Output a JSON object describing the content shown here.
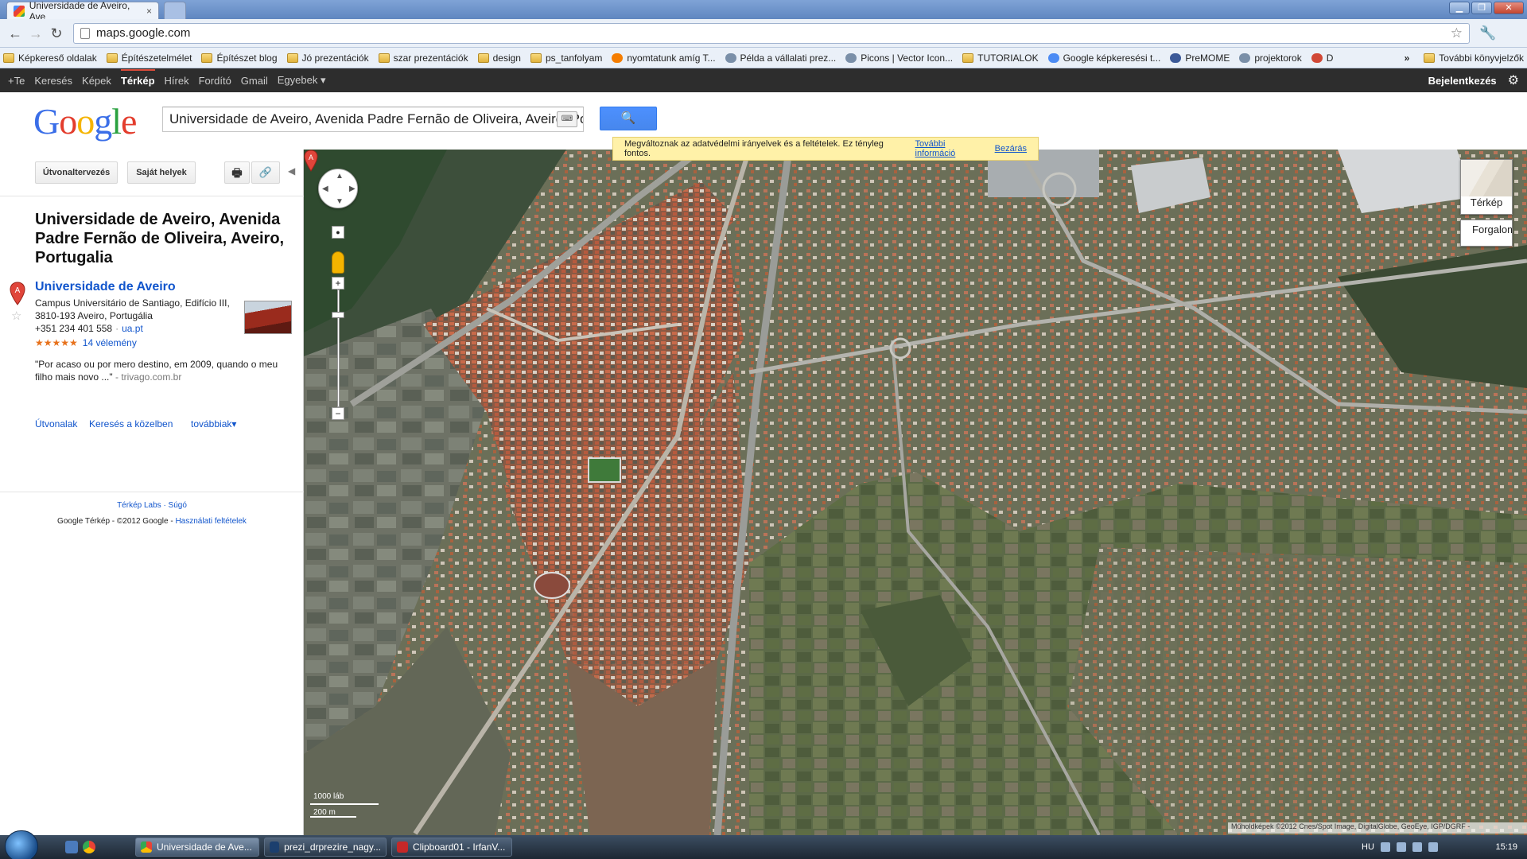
{
  "browser": {
    "tab_title": "Universidade de Aveiro, Ave",
    "tab_close": "×",
    "url": "maps.google.com",
    "window_min": "▁",
    "window_max": "❐",
    "window_close": "✕",
    "bookmarks": [
      {
        "label": "Képkereső oldalak",
        "icon": "folder-icon"
      },
      {
        "label": "Építészetelmélet",
        "icon": "folder-icon"
      },
      {
        "label": "Építészet blog",
        "icon": "folder-icon"
      },
      {
        "label": "Jó prezentációk",
        "icon": "folder-icon"
      },
      {
        "label": "szar prezentációk",
        "icon": "folder-icon"
      },
      {
        "label": "design",
        "icon": "folder-icon"
      },
      {
        "label": "ps_tanfolyam",
        "icon": "folder-icon"
      },
      {
        "label": "nyomtatunk amíg T...",
        "icon": "blogger-icon"
      },
      {
        "label": "Példa a vállalati prez...",
        "icon": "site-icon"
      },
      {
        "label": "Picons | Vector Icon...",
        "icon": "site-icon"
      },
      {
        "label": "TUTORIALOK",
        "icon": "folder-icon"
      },
      {
        "label": "Google képkeresési t...",
        "icon": "google-icon"
      },
      {
        "label": "PreMOME",
        "icon": "facebook-icon"
      },
      {
        "label": "projektorok",
        "icon": "site-icon"
      },
      {
        "label": "D",
        "icon": "gmail-icon"
      }
    ],
    "bookmarks_overflow": "»",
    "other_bookmarks": "További könyvjelzők"
  },
  "gbar": {
    "items": [
      "+Te",
      "Keresés",
      "Képek",
      "Térkép",
      "Hírek",
      "Fordító",
      "Gmail",
      "Egyebek ▾"
    ],
    "active_index": 3,
    "signin": "Bejelentkezés"
  },
  "search": {
    "logo": "Google",
    "query": "Universidade de Aveiro, Avenida Padre Fernão de Oliveira, Aveiro, Portugalia",
    "notice_text": "Megváltoznak az adatvédelmi irányelvek és a feltételek. Ez tényleg fontos.",
    "notice_more": "További információ",
    "notice_close": "Bezárás"
  },
  "panel": {
    "route_button": "Útvonaltervezés",
    "places_button": "Saját helyek",
    "place_title": "Universidade de Aveiro, Avenida Padre Fernão de Oliveira, Aveiro, Portugalia",
    "result": {
      "marker": "A",
      "name": "Universidade de Aveiro",
      "address_line1": "Campus Universitário de Santiago, Edifício III,",
      "address_line2": "3810-193 Aveiro, Portugália",
      "phone": "+351 234 401 558",
      "website": "ua.pt",
      "rating": 5,
      "stars": "★★★★★",
      "reviews": "14 vélemény",
      "quote": "\"Por acaso ou por mero destino, em 2009, quando o meu filho mais novo ...\"",
      "quote_source": "- trivago.com.br"
    },
    "links": {
      "routes": "Útvonalak",
      "nearby": "Keresés a közelben",
      "more": "továbbiak▾"
    },
    "footer_links": "Térkép Labs · Súgó",
    "footer_text": "Google Térkép - ©2012 Google -",
    "footer_terms": "Használati feltételek"
  },
  "map": {
    "type_label": "Térkép",
    "traffic_label": "Forgalom",
    "scale_ft": "1000 láb",
    "scale_m": "200 m",
    "copyright": "Műholdképek ©2012 Cnes/Spot Image, DigitalGlobe, GeoEye, IGP/DGRF -",
    "marker": "A"
  },
  "taskbar": {
    "tasks": [
      {
        "label": "Universidade de Ave...",
        "icon": "chrome-icon",
        "active": true
      },
      {
        "label": "prezi_drprezire_nagy...",
        "icon": "photoshop-icon",
        "active": false
      },
      {
        "label": "Clipboard01 - IrfanV...",
        "icon": "irfanview-icon",
        "active": false
      }
    ],
    "lang": "HU",
    "clock": "15:19"
  }
}
